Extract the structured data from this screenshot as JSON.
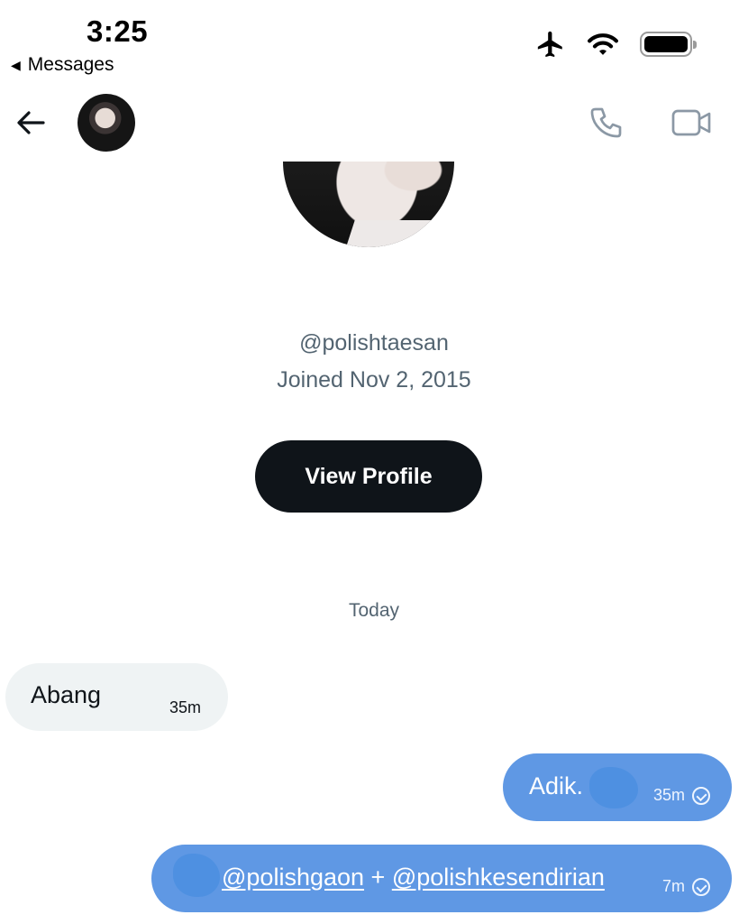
{
  "status_bar": {
    "time": "3:25",
    "back_app": "Messages",
    "back_app_arrow": "◀",
    "icons": [
      "airplane-icon",
      "wifi-icon",
      "battery-icon"
    ]
  },
  "header": {
    "back_icon": "arrow-left-icon",
    "avatar": "profile-avatar",
    "actions": [
      "phone-call-icon",
      "video-camera-icon"
    ]
  },
  "profile": {
    "handle": "@polishtaesan",
    "joined": "Joined Nov 2, 2015",
    "view_profile_label": "View Profile"
  },
  "conversation": {
    "day_separator": "Today",
    "messages": [
      {
        "direction": "incoming",
        "text": "Abang",
        "time": "35m"
      },
      {
        "direction": "outgoing",
        "text": "Adik.",
        "time": "35m",
        "status": "sent"
      },
      {
        "direction": "outgoing",
        "mention_1": "@polishgaon",
        "joiner": " + ",
        "mention_2": "@polishkesendirian",
        "time": "7m",
        "status": "sent"
      }
    ]
  },
  "colors": {
    "outgoing_bubble": "#5f98e4",
    "incoming_bubble": "#eff3f4",
    "primary_text": "#0f1419",
    "secondary_text": "#536471",
    "button_dark": "#0f1419"
  }
}
